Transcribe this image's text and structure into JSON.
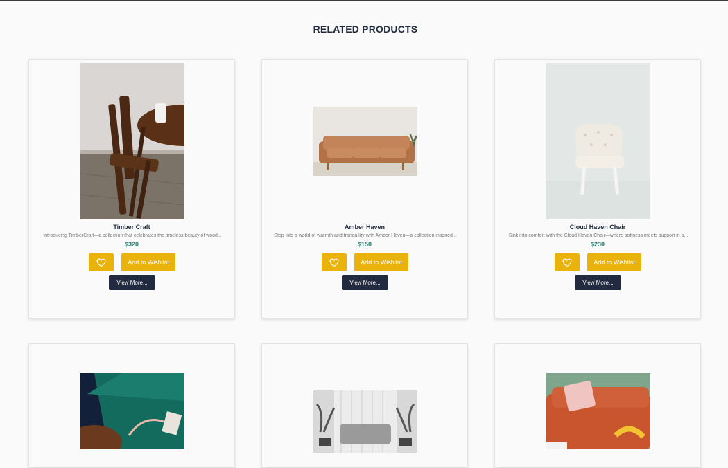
{
  "section": {
    "title": "RELATED PRODUCTS"
  },
  "icons": {
    "wishlist": "heart-icon"
  },
  "colors": {
    "accent": "#e9b30c",
    "price": "#2b7a6e",
    "dark_button": "#222a40"
  },
  "products": [
    {
      "name": "Timber Craft",
      "description": "Introducing TimberCraft—a collection that celebrates the timeless beauty of wood...",
      "price": "$320",
      "wishlist_label": "Add to Wishlist",
      "more_label": "View More..."
    },
    {
      "name": "Amber Haven",
      "description": "Step into a world of warmth and tranquility with Amber Haven—a collection inspired...",
      "price": "$150",
      "wishlist_label": "Add to Wishlist",
      "more_label": "View More..."
    },
    {
      "name": "Cloud Haven Chair",
      "description": "Sink into comfort with the Cloud Haven Chair—where softness meets support in a...",
      "price": "$230",
      "wishlist_label": "Add to Wishlist",
      "more_label": "View More..."
    }
  ]
}
